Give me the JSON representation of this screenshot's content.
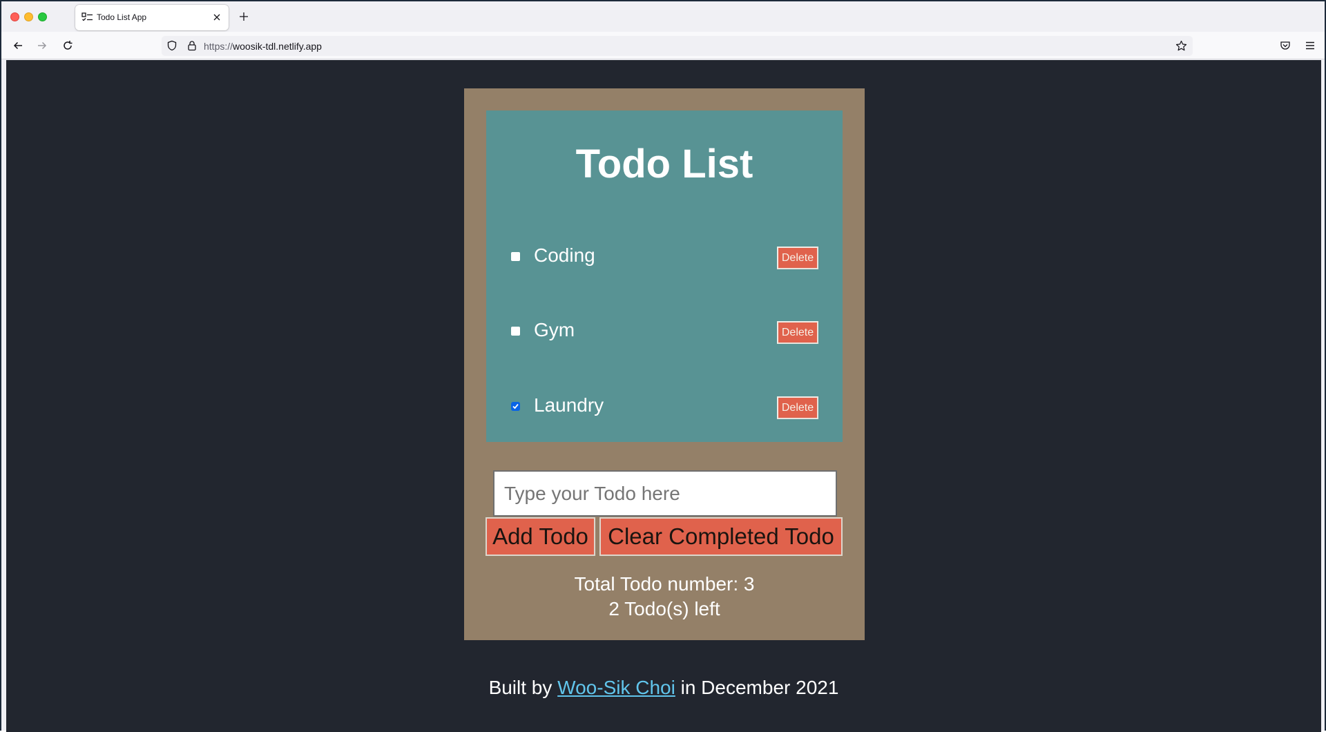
{
  "browser": {
    "tab_title": "Todo List App",
    "url_scheme": "https://",
    "url_host": "woosik-tdl.netlify.app"
  },
  "app": {
    "title": "Todo List",
    "todos": [
      {
        "text": "Coding",
        "completed": false,
        "delete_label": "Delete"
      },
      {
        "text": "Gym",
        "completed": false,
        "delete_label": "Delete"
      },
      {
        "text": "Laundry",
        "completed": true,
        "delete_label": "Delete"
      }
    ],
    "input_placeholder": "Type your Todo here",
    "add_button": "Add Todo",
    "clear_button": "Clear Completed Todo",
    "total_label": "Total Todo number: 3",
    "left_label": "2 Todo(s) left"
  },
  "footer": {
    "prefix": "Built by",
    "author": "Woo-Sik Choi",
    "suffix": "in December 2021"
  },
  "colors": {
    "page_bg": "#22262f",
    "card_bg": "#948068",
    "list_bg": "#589394",
    "button_bg": "#e0624c",
    "link": "#61c5ec"
  },
  "icons": [
    "back-icon",
    "forward-icon",
    "reload-icon",
    "shield-icon",
    "lock-icon",
    "bookmark-star-icon",
    "pocket-icon",
    "menu-icon",
    "todo-favicon",
    "close-icon",
    "plus-icon"
  ]
}
